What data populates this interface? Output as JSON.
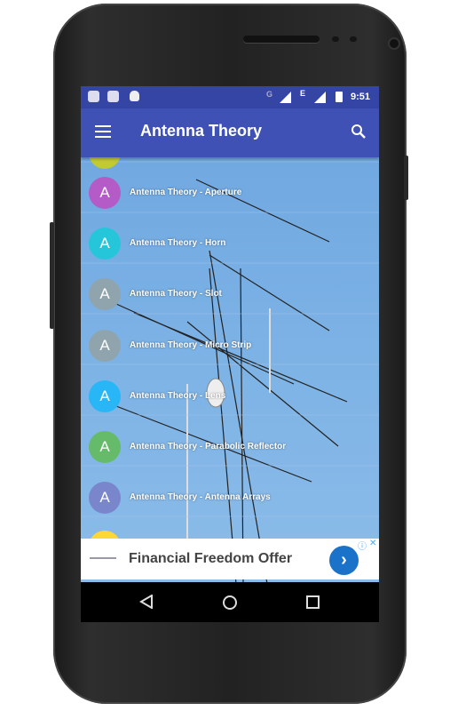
{
  "status": {
    "time": "9:51",
    "net1": "G",
    "net2": "E"
  },
  "appbar": {
    "title": "Antenna Theory",
    "menu_icon": "hamburger-menu-icon",
    "search_icon": "search-icon"
  },
  "list": [
    {
      "letter": "A",
      "label": "Antenna Theory - Aperture",
      "color": "#b45bc8"
    },
    {
      "letter": "A",
      "label": "Antenna Theory - Horn",
      "color": "#26c6da"
    },
    {
      "letter": "A",
      "label": "Antenna Theory - Slot",
      "color": "#90a4ae"
    },
    {
      "letter": "A",
      "label": "Antenna Theory - Micro Strip",
      "color": "#90a4ae"
    },
    {
      "letter": "A",
      "label": "Antenna Theory - Lens",
      "color": "#29b6f6"
    },
    {
      "letter": "A",
      "label": "Antenna Theory - Parabolic Reflector",
      "color": "#66bb6a"
    },
    {
      "letter": "A",
      "label": "Antenna Theory - Antenna Arrays",
      "color": "#7986cb"
    }
  ],
  "ad": {
    "text": "Financial Freedom Offer",
    "accent": "#1a73c8"
  },
  "colors": {
    "primary": "#3f51b5",
    "status": "#3545a6"
  }
}
